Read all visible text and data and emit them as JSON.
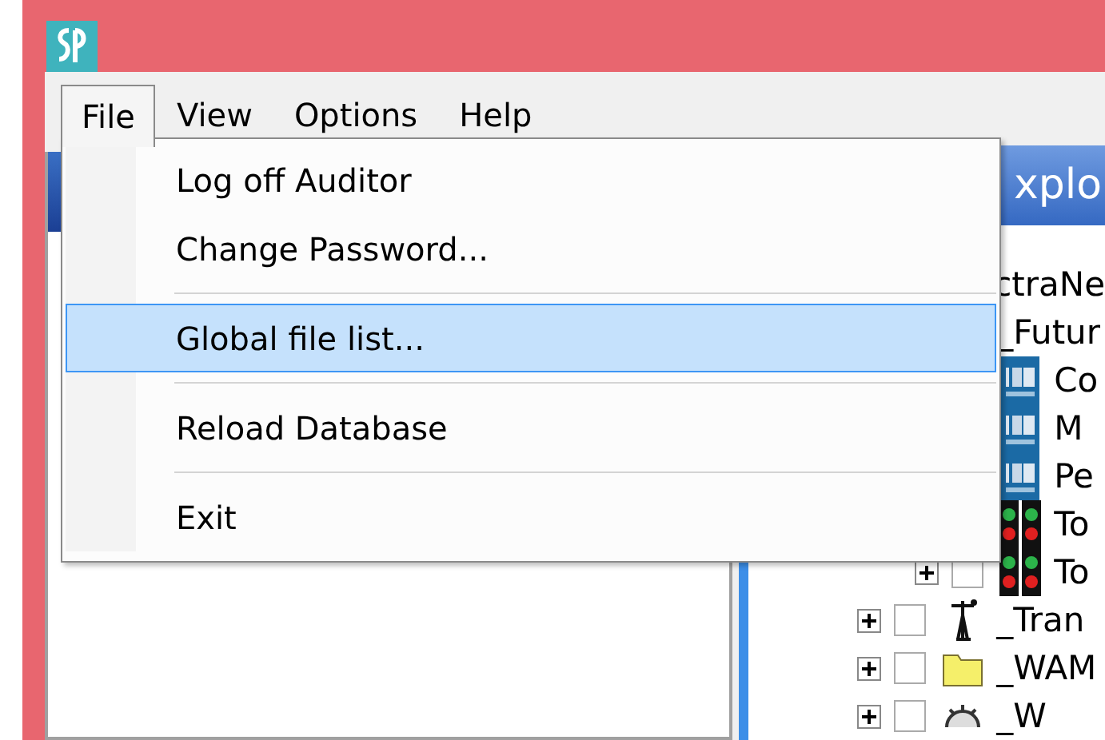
{
  "menu_bar": [
    {
      "label": "File",
      "selected": true
    },
    {
      "label": "View",
      "selected": false
    },
    {
      "label": "Options",
      "selected": false
    },
    {
      "label": "Help",
      "selected": false
    }
  ],
  "file_menu": [
    {
      "kind": "item",
      "label": "Log off Auditor",
      "selected": false
    },
    {
      "kind": "item",
      "label": "Change Password...",
      "selected": false
    },
    {
      "kind": "separator"
    },
    {
      "kind": "item",
      "label": "Global file list...",
      "selected": true
    },
    {
      "kind": "separator"
    },
    {
      "kind": "item",
      "label": "Reload Database",
      "selected": false
    },
    {
      "kind": "separator"
    },
    {
      "kind": "item",
      "label": "Exit",
      "selected": false
    }
  ],
  "explorer": {
    "title": "xplo",
    "tree": [
      {
        "label": "ctraNe",
        "children": [
          {
            "label": "_Futur",
            "children": [
              {
                "label": "Co",
                "kind": "ied"
              },
              {
                "label": "M",
                "kind": "ied"
              },
              {
                "label": "Pe",
                "kind": "ied"
              },
              {
                "label": "To",
                "kind": "lights"
              },
              {
                "label": "To",
                "kind": "lights",
                "expanded": false,
                "checked": false
              }
            ]
          },
          {
            "label": "_Tran",
            "kind": "tower",
            "expanded": false,
            "checked": false
          },
          {
            "label": "_WAM",
            "kind": "folder",
            "expanded": false,
            "checked": false
          },
          {
            "label": "_W",
            "kind": "gear",
            "expanded": false,
            "checked": false
          }
        ]
      }
    ]
  }
}
